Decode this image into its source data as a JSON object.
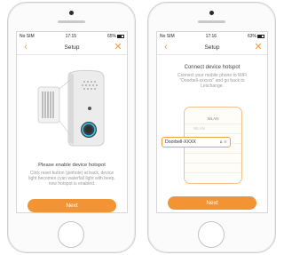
{
  "left": {
    "status": {
      "carrier": "No SIM",
      "time": "17:15",
      "battery": "65%"
    },
    "nav": {
      "back": "‹",
      "title": "Setup",
      "close": "✕"
    },
    "message_title": "Please enable device hotspot",
    "message_body": "Click reset button (pinhole) at back, device light becomes cyan waterfall light with beep, now hotspot is enabled.",
    "next_label": "Next"
  },
  "right": {
    "status": {
      "carrier": "No SIM",
      "time": "17:16",
      "battery": "63%"
    },
    "nav": {
      "back": "‹",
      "title": "Setup",
      "close": "✕"
    },
    "message_title": "Connect device hotspot",
    "message_body": "Connect your mobile phone to WiFi \"Doorbell-xxxxxx\" and go back to Leschange.",
    "wlan_header": "WLAN",
    "wifi_rows": [
      "WLAN",
      "",
      "",
      "",
      "",
      ""
    ],
    "selected_ssid": "Doorbell-XXXX",
    "next_label": "Next"
  }
}
